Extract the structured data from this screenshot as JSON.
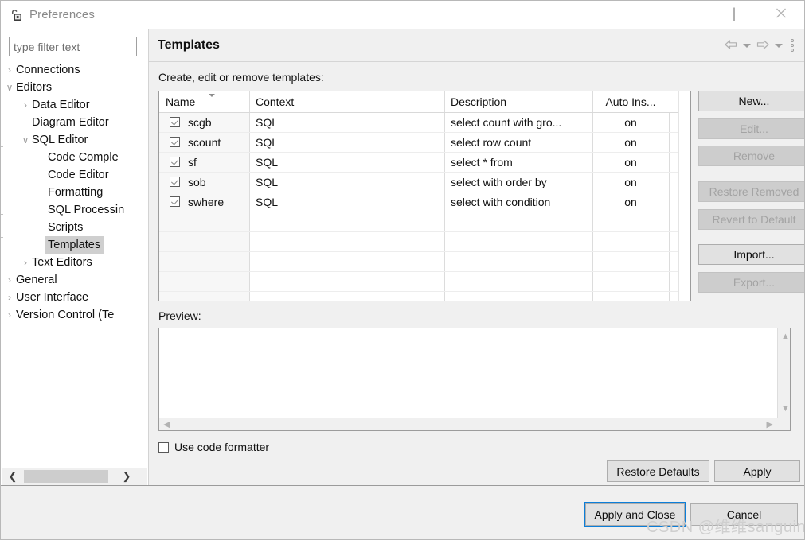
{
  "window": {
    "title": "Preferences",
    "app_icon": "preferences-app-icon",
    "controls": {
      "minimize": "minimize-icon",
      "maximize": "maximize-icon",
      "close": "close-icon"
    }
  },
  "filter": {
    "placeholder": "type filter text",
    "value": ""
  },
  "tree": {
    "items": [
      {
        "label": "Connections",
        "indent": 0,
        "twisty": "collapsed",
        "selected": false
      },
      {
        "label": "Editors",
        "indent": 0,
        "twisty": "expanded",
        "selected": false
      },
      {
        "label": "Data Editor",
        "indent": 1,
        "twisty": "collapsed",
        "selected": false
      },
      {
        "label": "Diagram Editor",
        "indent": 1,
        "twisty": "none",
        "selected": false
      },
      {
        "label": "SQL Editor",
        "indent": 1,
        "twisty": "expanded",
        "selected": false
      },
      {
        "label": "Code Comple",
        "indent": 2,
        "twisty": "none",
        "selected": false
      },
      {
        "label": "Code Editor",
        "indent": 2,
        "twisty": "none",
        "selected": false
      },
      {
        "label": "Formatting",
        "indent": 2,
        "twisty": "none",
        "selected": false
      },
      {
        "label": "SQL Processin",
        "indent": 2,
        "twisty": "none",
        "selected": false
      },
      {
        "label": "Scripts",
        "indent": 2,
        "twisty": "none",
        "selected": false
      },
      {
        "label": "Templates",
        "indent": 2,
        "twisty": "none",
        "selected": true
      },
      {
        "label": "Text Editors",
        "indent": 1,
        "twisty": "collapsed",
        "selected": false
      },
      {
        "label": "General",
        "indent": 0,
        "twisty": "collapsed",
        "selected": false
      },
      {
        "label": "User Interface",
        "indent": 0,
        "twisty": "collapsed",
        "selected": false
      },
      {
        "label": "Version Control (Te",
        "indent": 0,
        "twisty": "collapsed",
        "selected": false
      }
    ],
    "scrollbar": {
      "left_arrow": "chevron-left-icon",
      "right_arrow": "chevron-right-icon"
    }
  },
  "panel": {
    "title": "Templates",
    "nav": {
      "back": "back-arrow-icon",
      "back_menu": "chevron-down-icon",
      "forward": "forward-arrow-icon",
      "forward_menu": "chevron-down-icon",
      "view_menu": "vertical-dots-menu-icon"
    },
    "section_label": "Create, edit or remove templates:",
    "preview_label": "Preview:"
  },
  "table": {
    "columns": [
      {
        "label": "Name",
        "sorted": true
      },
      {
        "label": "Context",
        "sorted": false
      },
      {
        "label": "Description",
        "sorted": false
      },
      {
        "label": "Auto Ins...",
        "sorted": false
      }
    ],
    "rows": [
      {
        "checked": true,
        "name": "scgb",
        "context": "SQL",
        "description": "select count with gro...",
        "auto_insert": "on"
      },
      {
        "checked": true,
        "name": "scount",
        "context": "SQL",
        "description": "select row count",
        "auto_insert": "on"
      },
      {
        "checked": true,
        "name": "sf",
        "context": "SQL",
        "description": "select * from",
        "auto_insert": "on"
      },
      {
        "checked": true,
        "name": "sob",
        "context": "SQL",
        "description": "select with order by",
        "auto_insert": "on"
      },
      {
        "checked": true,
        "name": "swhere",
        "context": "SQL",
        "description": "select with condition",
        "auto_insert": "on"
      }
    ]
  },
  "side_buttons": [
    {
      "label": "New...",
      "enabled": true
    },
    {
      "label": "Edit...",
      "enabled": false
    },
    {
      "label": "Remove",
      "enabled": false
    },
    {
      "label": "Restore Removed",
      "enabled": false
    },
    {
      "label": "Revert to Default",
      "enabled": false
    },
    {
      "label": "Import...",
      "enabled": true
    },
    {
      "label": "Export...",
      "enabled": false
    }
  ],
  "preview": {
    "content": "",
    "scroll": {
      "up": "chevron-up-icon",
      "down": "chevron-down-icon",
      "left": "chevron-left-icon",
      "right": "chevron-right-icon"
    }
  },
  "code_formatter": {
    "label": "Use code formatter",
    "checked": false
  },
  "footer": {
    "restore_defaults": "Restore Defaults",
    "apply": "Apply",
    "apply_and_close": "Apply and Close",
    "cancel": "Cancel"
  },
  "watermark": "CSDN @维维sanguine",
  "colors": {
    "focus_outline": "#0c7ed8",
    "panel_bg": "#f0f0f0",
    "button_bg": "#e1e1e1",
    "selection_bg": "#cfcfcf"
  }
}
